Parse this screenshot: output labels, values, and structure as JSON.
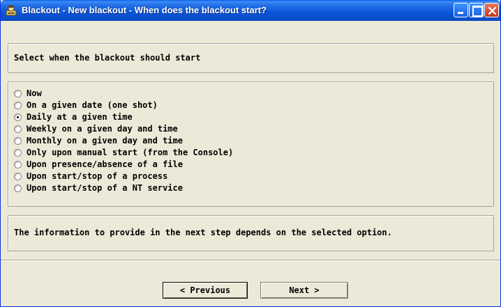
{
  "window": {
    "title": "Blackout - New blackout - When does the blackout start?"
  },
  "header": {
    "instruction": "Select when the blackout should start"
  },
  "options": [
    {
      "label": "Now",
      "checked": false
    },
    {
      "label": "On a given date (one shot)",
      "checked": false
    },
    {
      "label": "Daily at a given time",
      "checked": true
    },
    {
      "label": "Weekly on a given day and time",
      "checked": false
    },
    {
      "label": "Monthly on a given day and time",
      "checked": false
    },
    {
      "label": "Only upon manual start (from the Console)",
      "checked": false
    },
    {
      "label": "Upon presence/absence of a file",
      "checked": false
    },
    {
      "label": "Upon start/stop of a process",
      "checked": false
    },
    {
      "label": "Upon start/stop of a NT service",
      "checked": false
    }
  ],
  "info": {
    "text": "The information to provide in the next step depends on the selected option."
  },
  "buttons": {
    "previous": "< Previous",
    "next": "Next >"
  }
}
